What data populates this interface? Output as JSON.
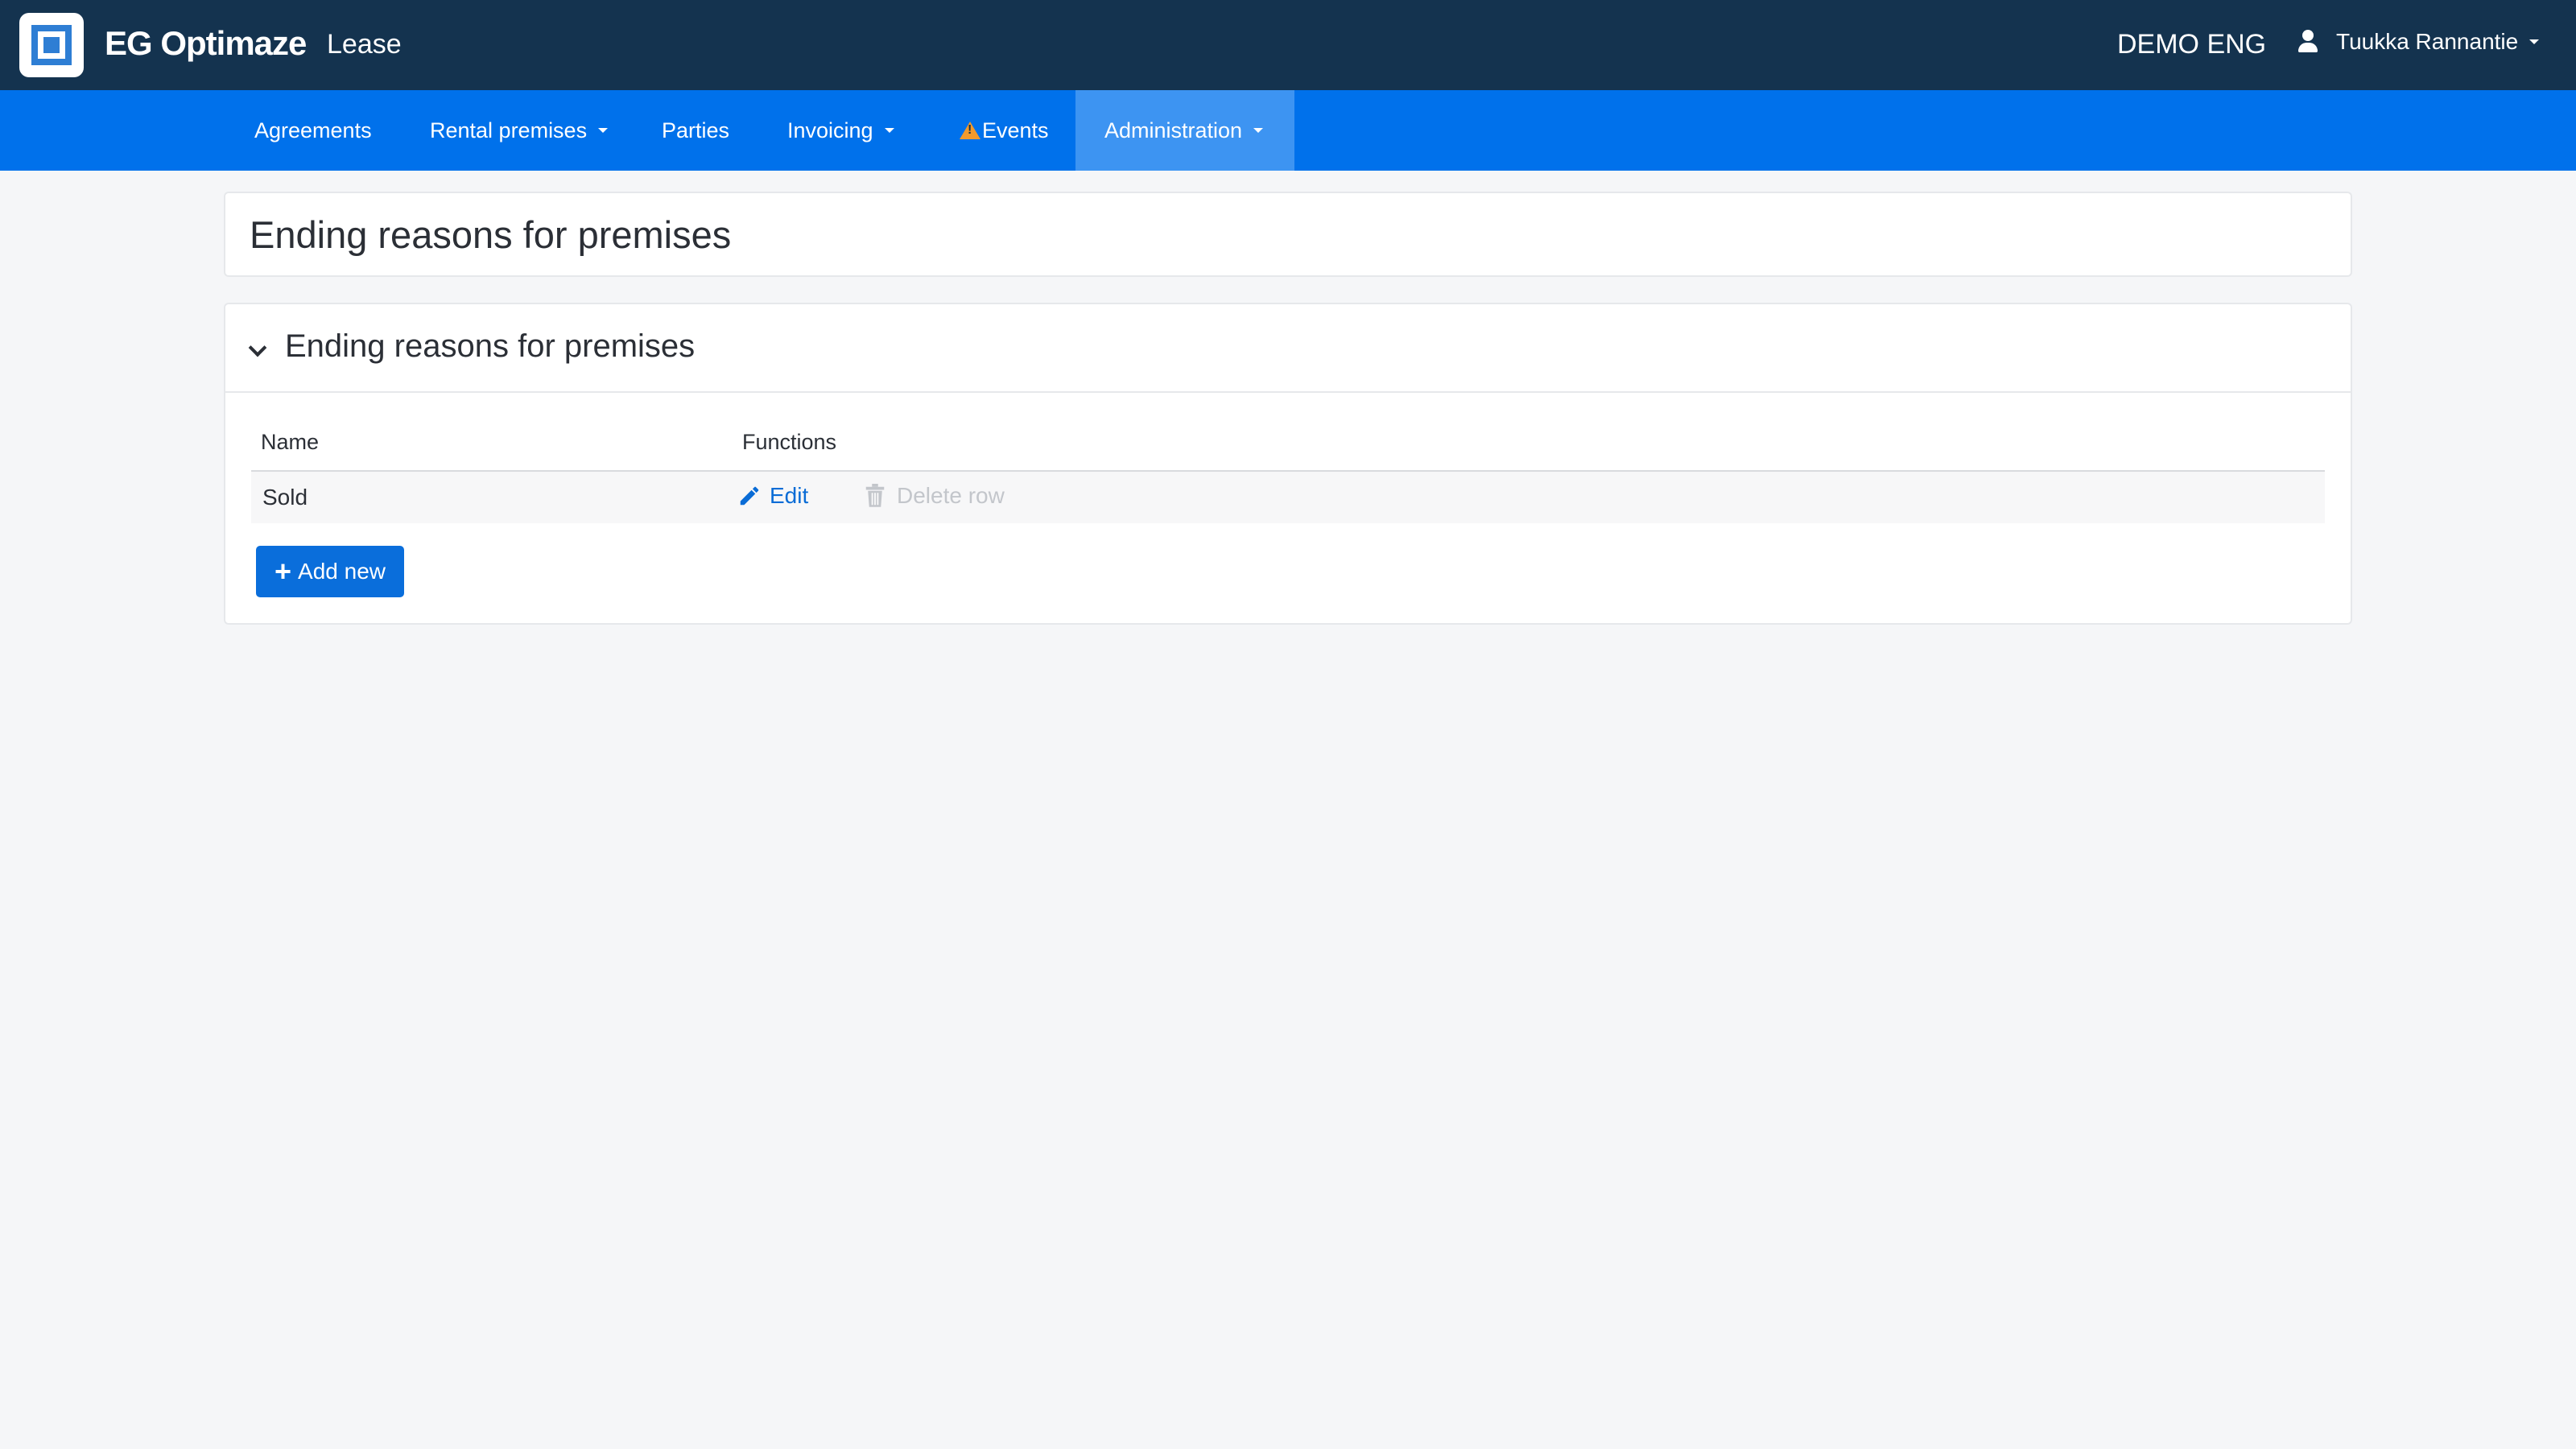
{
  "header": {
    "brand": "EG Optimaze",
    "module": "Lease",
    "tenant": "DEMO ENG",
    "user_name": "Tuukka Rannantie"
  },
  "nav": {
    "items": [
      {
        "label": "Agreements",
        "dropdown": false
      },
      {
        "label": "Rental premises",
        "dropdown": true
      },
      {
        "label": "Parties",
        "dropdown": false
      },
      {
        "label": "Invoicing",
        "dropdown": true
      },
      {
        "label": "Events",
        "dropdown": false,
        "icon": "warning-icon"
      },
      {
        "label": "Administration",
        "dropdown": true,
        "active": true
      }
    ]
  },
  "page": {
    "title": "Ending reasons for premises"
  },
  "section": {
    "title": "Ending reasons for premises",
    "columns": [
      "Name",
      "Functions"
    ],
    "rows": [
      {
        "name": "Sold",
        "edit_label": "Edit",
        "delete_label": "Delete row"
      }
    ],
    "add_label": "Add new"
  },
  "colors": {
    "header_bg": "#14334f",
    "nav_bg": "#0071eb",
    "nav_active_bg": "#3d94f2",
    "link": "#0a6cd6",
    "button_bg": "#0a6edb",
    "warning": "#f39a2b"
  }
}
